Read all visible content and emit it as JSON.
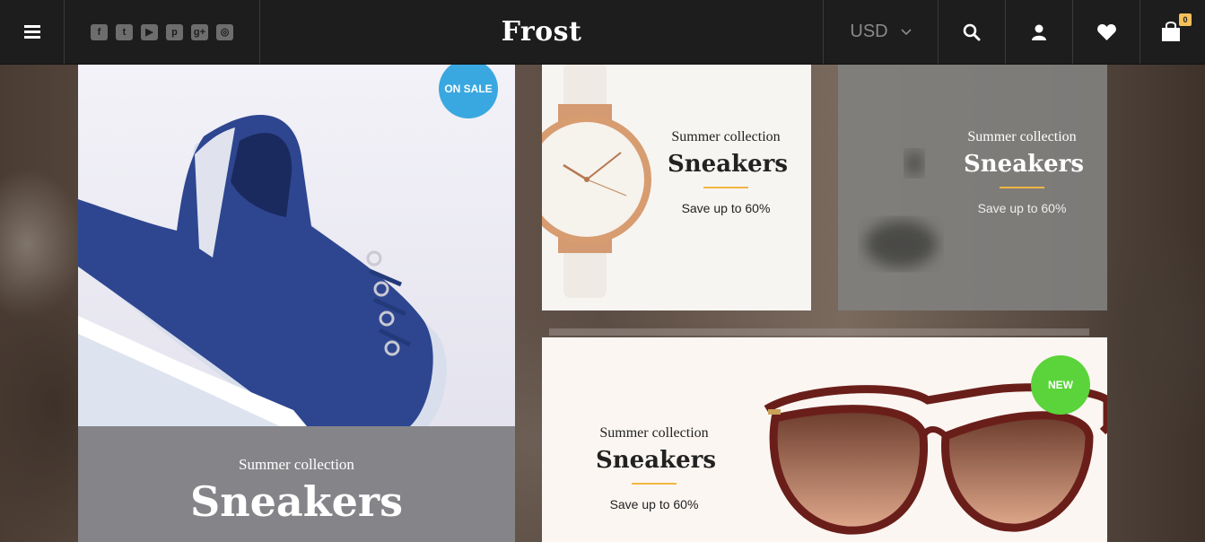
{
  "header": {
    "brand": "Frost",
    "currency": "USD",
    "cart_count": "0",
    "social_icons": [
      "facebook-icon",
      "twitter-icon",
      "youtube-icon",
      "pinterest-icon",
      "google-plus-icon",
      "instagram-icon"
    ]
  },
  "tiles": {
    "shoe": {
      "badge": "ON SALE",
      "subtitle": "Summer collection",
      "title": "Sneakers"
    },
    "watch": {
      "subtitle": "Summer collection",
      "title": "Sneakers",
      "save_text": "Save up to 60%"
    },
    "blur": {
      "subtitle": "Summer collection",
      "title": "Sneakers",
      "save_text": "Save up to 60%"
    },
    "sunglasses": {
      "badge": "NEW",
      "subtitle": "Summer collection",
      "title": "Sneakers",
      "save_text": "Save up to 60%"
    }
  },
  "colors": {
    "header_bg": "#1d1d1d",
    "accent_line": "#f2b643",
    "on_sale_badge": "#3aa8e0",
    "new_badge": "#5ad43a",
    "cart_badge": "#f4c15a"
  }
}
